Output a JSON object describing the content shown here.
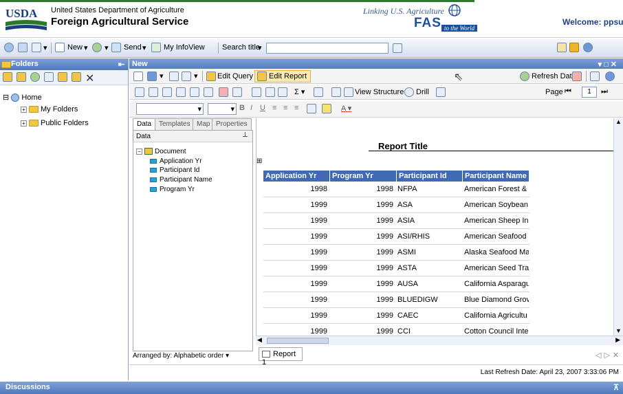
{
  "header": {
    "org_name": "United States Department of Agriculture",
    "agency_name": "Foreign Agricultural Service",
    "logo_text": "USDA",
    "tagline": "Linking U.S. Agriculture",
    "fas_logo": "FAS",
    "world_text": "to the World",
    "welcome": "Welcome: ppsus"
  },
  "toolbar1": {
    "new_label": "New",
    "send_label": "Send",
    "my_infoview_label": "My InfoView",
    "search_label": "Search title",
    "search_value": ""
  },
  "folders_panel": {
    "title": "Folders",
    "tree": [
      "Home",
      "My Folders",
      "Public Folders"
    ]
  },
  "report_panel": {
    "title": "New",
    "edit_query_label": "Edit Query",
    "edit_report_label": "Edit Report",
    "refresh_data_label": "Refresh Data",
    "view_structure_label": "View Structure",
    "drill_label": "Drill",
    "page_label": "Page",
    "page_number": "1"
  },
  "left_tabs": [
    "Data",
    "Templates",
    "Map",
    "Properties"
  ],
  "data_tree": {
    "header": "Data",
    "root": "Document",
    "fields": [
      "Application Yr",
      "Participant Id",
      "Participant Name",
      "Program Yr"
    ]
  },
  "arranged_by": "Arranged by: Alphabetic order",
  "report": {
    "title": "Report Title",
    "columns": [
      "Application Yr",
      "Program Yr",
      "Participant Id",
      "Participant Name"
    ],
    "rows": [
      [
        "1998",
        "1998",
        "NFPA",
        "American Forest &"
      ],
      [
        "1999",
        "1999",
        "ASA",
        "American Soybean"
      ],
      [
        "1999",
        "1999",
        "ASIA",
        "American Sheep In"
      ],
      [
        "1999",
        "1999",
        "ASI/RHIS",
        "American Seafood"
      ],
      [
        "1999",
        "1999",
        "ASMI",
        "Alaska Seafood Ma"
      ],
      [
        "1999",
        "1999",
        "ASTA",
        "American Seed Tra"
      ],
      [
        "1999",
        "1999",
        "AUSA",
        "California Asparagu"
      ],
      [
        "1999",
        "1999",
        "BLUEDIGW",
        "Blue Diamond Grov"
      ],
      [
        "1999",
        "1999",
        "CAEC",
        "California Agricultu"
      ],
      [
        "1999",
        "1999",
        "CCI",
        "Cotton Council Inte"
      ]
    ],
    "tab_label": "Report 1"
  },
  "status": {
    "last_refresh": "Last Refresh Date: April 23, 2007 3:33:06 PM"
  },
  "discussions_label": "Discussions"
}
